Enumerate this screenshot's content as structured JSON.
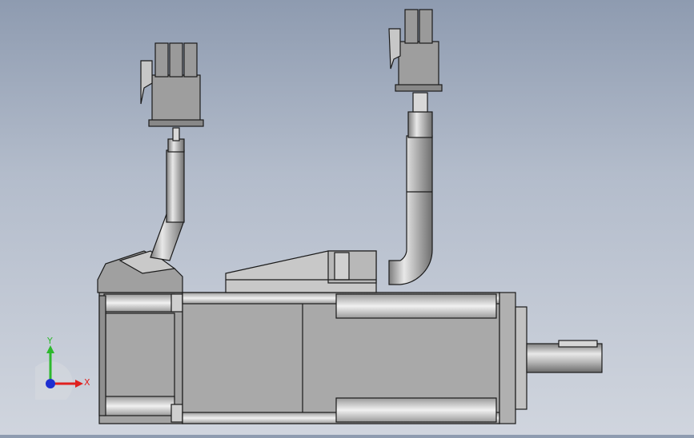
{
  "viewport": {
    "background_top": "#8e9bb0",
    "background_bottom": "#d0d5de",
    "part_color": "#a9a9a9",
    "edge_color": "#1a1a1a"
  },
  "triad": {
    "x_label": "X",
    "y_label": "Y",
    "x_color": "#e0201f",
    "y_color": "#2db82d",
    "z_color": "#1e2fd1"
  }
}
